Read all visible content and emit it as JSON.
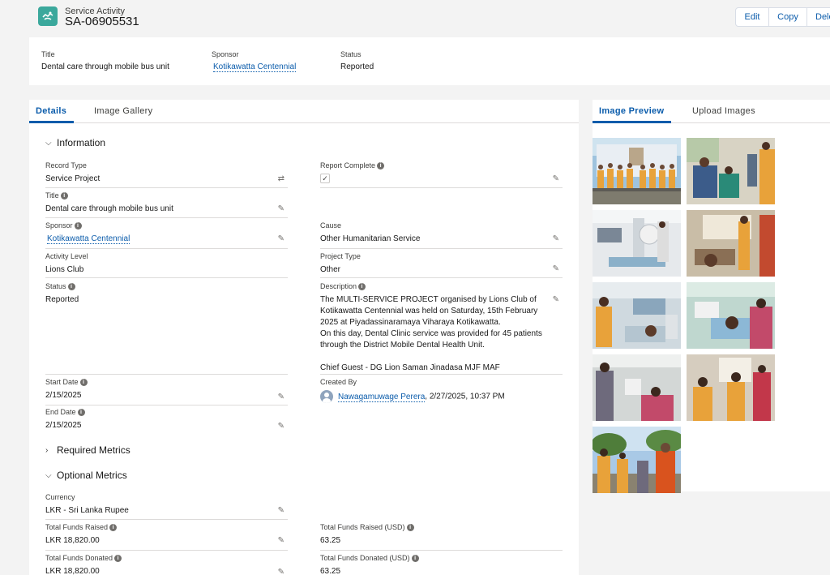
{
  "header": {
    "object_type": "Service Activity",
    "record_name": "SA-06905531",
    "buttons": {
      "edit": "Edit",
      "copy": "Copy",
      "delete": "Dele"
    }
  },
  "highlights": [
    {
      "label": "Title",
      "value": "Dental care through mobile bus unit"
    },
    {
      "label": "Sponsor",
      "value": "Kotikawatta Centennial"
    },
    {
      "label": "Status",
      "value": "Reported"
    }
  ],
  "left_tabs": [
    "Details",
    "Image Gallery"
  ],
  "right_tabs": [
    "Image Preview",
    "Upload Images"
  ],
  "sections": {
    "information": "Information",
    "required_metrics": "Required Metrics",
    "optional_metrics": "Optional Metrics"
  },
  "fields": {
    "record_type": {
      "label": "Record Type",
      "value": "Service Project"
    },
    "report_complete": {
      "label": "Report Complete",
      "value": "✓"
    },
    "title": {
      "label": "Title",
      "value": "Dental care through mobile bus unit"
    },
    "sponsor": {
      "label": "Sponsor",
      "value": "Kotikawatta Centennial"
    },
    "cause": {
      "label": "Cause",
      "value": "Other Humanitarian Service"
    },
    "activity_level": {
      "label": "Activity Level",
      "value": "Lions Club"
    },
    "project_type": {
      "label": "Project Type",
      "value": "Other"
    },
    "status": {
      "label": "Status",
      "value": "Reported"
    },
    "description": {
      "label": "Description",
      "lines": [
        "The MULTI-SERVICE PROJECT organised by Lions Club of",
        "Kotikawatta Centennial was held on Saturday, 15th February",
        "2025 at Piyadassinaramaya Viharaya Kotikawatta.",
        "On this day, Dental Clinic service was provided for 45 patients",
        "through the District Mobile Dental Health Unit.",
        "",
        "Chief Guest - DG Lion Saman Jinadasa MJF MAF"
      ]
    },
    "start_date": {
      "label": "Start Date",
      "value": "2/15/2025"
    },
    "created_by": {
      "label": "Created By",
      "user": "Nawagamuwage Perera",
      "date": ", 2/27/2025, 10:37 PM"
    },
    "end_date": {
      "label": "End Date",
      "value": "2/15/2025"
    },
    "currency": {
      "label": "Currency",
      "value": "LKR - Sri Lanka Rupee"
    },
    "total_funds_raised": {
      "label": "Total Funds Raised",
      "value": "LKR 18,820.00"
    },
    "total_funds_raised_usd": {
      "label": "Total Funds Raised (USD)",
      "value": "63.25"
    },
    "total_funds_donated": {
      "label": "Total Funds Donated",
      "value": "LKR 18,820.00"
    },
    "total_funds_donated_usd": {
      "label": "Total Funds Donated (USD)",
      "value": "63.25"
    }
  },
  "colors": {
    "brand": "#0b5cab",
    "icon_teal": "#3ba89c",
    "orange_vest": "#e8a23a",
    "saffron_robe": "#d9531e"
  }
}
